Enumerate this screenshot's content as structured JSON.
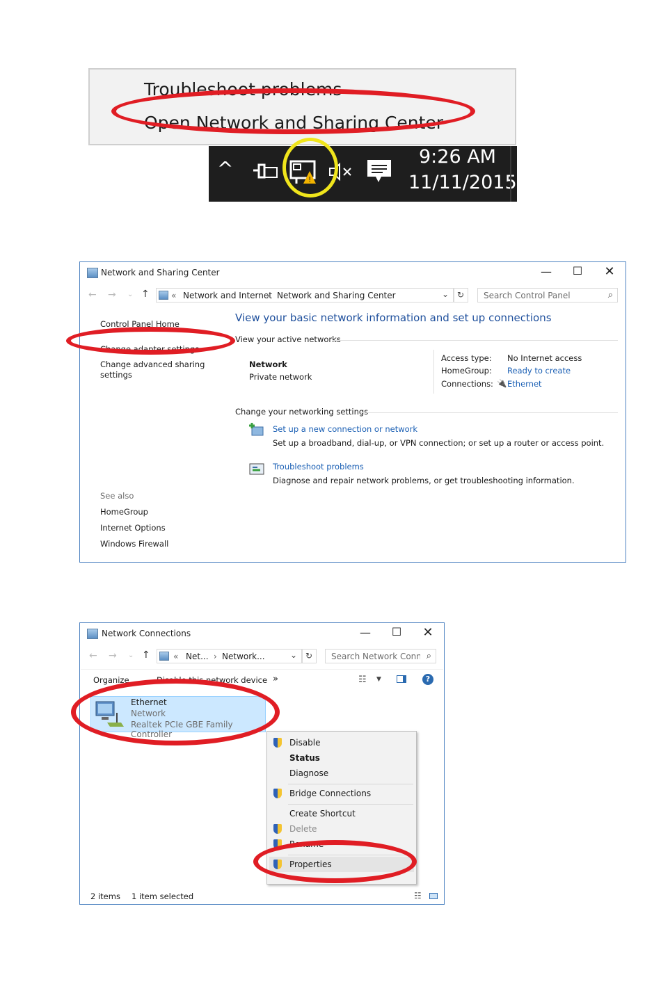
{
  "tray": {
    "menu": {
      "troubleshoot": "Troubleshoot problems",
      "open_center": "Open Network and Sharing Center"
    },
    "clock": {
      "time": "9:26 AM",
      "date": "11/11/2015"
    }
  },
  "nsc": {
    "title": "Network and Sharing Center",
    "breadcrumb": {
      "sep_start": "«",
      "part1": "Network and Internet",
      "arrow": "›",
      "part2": "Network and Sharing Center"
    },
    "search_placeholder": "Search Control Panel",
    "sidebar": {
      "home": "Control Panel Home",
      "change_adapter": "Change adapter settings",
      "change_sharing_1": "Change advanced sharing",
      "change_sharing_2": "settings",
      "see_also": "See also",
      "homegroup": "HomeGroup",
      "internet_options": "Internet Options",
      "firewall": "Windows Firewall"
    },
    "heading": "View your basic network information and set up connections",
    "active_networks": "View your active networks",
    "network_name": "Network",
    "network_type": "Private network",
    "access_type_label": "Access type:",
    "access_type_value": "No Internet access",
    "homegroup_label": "HomeGroup:",
    "homegroup_value": "Ready to create",
    "connections_label": "Connections:",
    "connections_value": "Ethernet",
    "change_settings": "Change your networking settings",
    "setup_link": "Set up a new connection or network",
    "setup_desc": "Set up a broadband, dial-up, or VPN connection; or set up a router or access point.",
    "troubleshoot_link": "Troubleshoot problems",
    "troubleshoot_desc": "Diagnose and repair network problems, or get troubleshooting information."
  },
  "nc": {
    "title": "Network Connections",
    "breadcrumb": {
      "sep_start": "«",
      "part1": "Net...",
      "arrow": "›",
      "part2": "Network..."
    },
    "search_placeholder": "Search Network Conn...",
    "toolbar": {
      "organize": "Organize",
      "disable": "Disable this network device",
      "more": "»"
    },
    "adapter": {
      "name": "Ethernet",
      "network": "Network",
      "device": "Realtek PCIe GBE Family Controller"
    },
    "status": {
      "items": "2 items",
      "selected": "1 item selected"
    },
    "context_menu": {
      "disable": "Disable",
      "status": "Status",
      "diagnose": "Diagnose",
      "bridge": "Bridge Connections",
      "shortcut": "Create Shortcut",
      "delete": "Delete",
      "rename": "Rename",
      "properties": "Properties"
    }
  },
  "colors": {
    "annotation_red": "#e01d24",
    "annotation_yellow": "#f0e51c",
    "link_blue": "#1a5fb4",
    "heading_blue": "#1e4f9c"
  }
}
